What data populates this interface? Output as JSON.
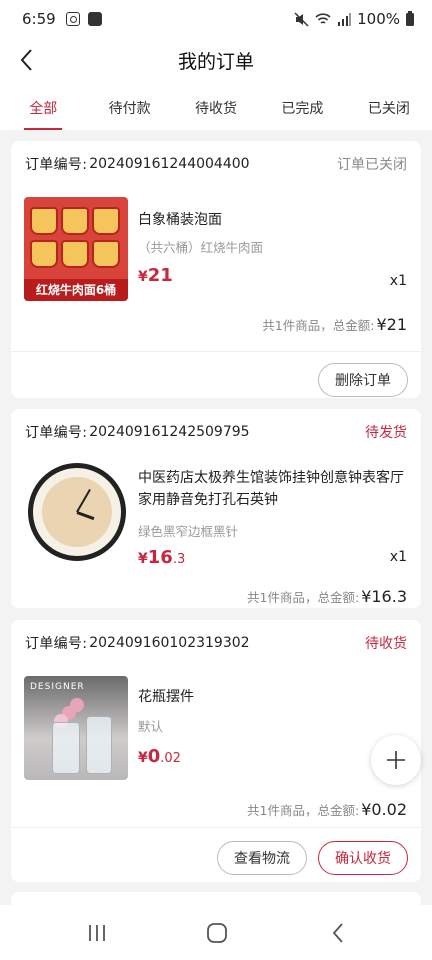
{
  "status_bar": {
    "time": "6:59",
    "battery": "100%"
  },
  "header": {
    "title": "我的订单"
  },
  "tabs": [
    {
      "label": "全部"
    },
    {
      "label": "待付款"
    },
    {
      "label": "待收货"
    },
    {
      "label": "已完成"
    },
    {
      "label": "已关闭"
    }
  ],
  "orders": [
    {
      "label": "订单编号:",
      "number": "202409161244004400",
      "status": "订单已关闭",
      "product": {
        "name": "白象桶装泡面",
        "spec": "（共六桶）红烧牛肉面",
        "currency": "¥",
        "price_int": "21",
        "price_dec": "",
        "qty": "x1",
        "image_caption": "红烧牛肉面6桶"
      },
      "summary_text": "共1件商品，总金额:",
      "total": "¥21",
      "buttons": [
        "删除订单"
      ]
    },
    {
      "label": "订单编号:",
      "number": "202409161242509795",
      "status": "待发货",
      "product": {
        "name": "中医药店太极养生馆装饰挂钟创意钟表客厅家用静音免打孔石英钟",
        "spec": "绿色黑窄边框黑针",
        "currency": "¥",
        "price_int": "16",
        "price_dec": ".3",
        "qty": "x1"
      },
      "summary_text": "共1件商品，总金额:",
      "total": "¥16.3",
      "buttons": []
    },
    {
      "label": "订单编号:",
      "number": "202409160102319302",
      "status": "待收货",
      "product": {
        "name": "花瓶摆件",
        "spec": "默认",
        "currency": "¥",
        "price_int": "0",
        "price_dec": ".02",
        "qty": "",
        "image_caption": "DESIGNER"
      },
      "summary_text": "共1件商品，总金额:",
      "total": "¥0.02",
      "buttons": [
        "查看物流",
        "确认收货"
      ]
    }
  ],
  "colors": {
    "accent": "#c8283f",
    "background": "#f3f3f3"
  }
}
